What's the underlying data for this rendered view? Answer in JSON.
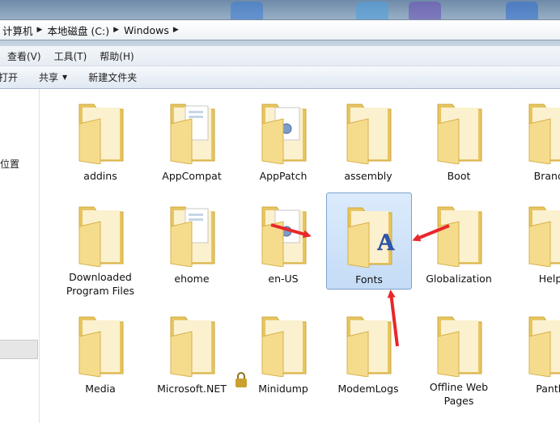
{
  "breadcrumb": {
    "items": [
      "计算机",
      "本地磁盘 (C:)",
      "Windows"
    ]
  },
  "menu": {
    "items": [
      "查看(V)",
      "工具(T)",
      "帮助(H)"
    ]
  },
  "toolbar": {
    "open_label": "打开",
    "share_label": "共享",
    "new_folder_label": "新建文件夹"
  },
  "nav": {
    "location_label": "位置"
  },
  "folders": [
    {
      "label": "addins"
    },
    {
      "label": "AppCompat"
    },
    {
      "label": "AppPatch"
    },
    {
      "label": "assembly"
    },
    {
      "label": "Boot"
    },
    {
      "label": "Brandi"
    },
    {
      "label": "Downloaded Program Files"
    },
    {
      "label": "ehome"
    },
    {
      "label": "en-US"
    },
    {
      "label": "Fonts",
      "selected": true
    },
    {
      "label": "Globalization"
    },
    {
      "label": "Help"
    },
    {
      "label": "Media"
    },
    {
      "label": "Microsoft.NET"
    },
    {
      "label": "Minidump",
      "locked": true
    },
    {
      "label": "ModemLogs"
    },
    {
      "label": "Offline Web Pages"
    },
    {
      "label": "Panth"
    }
  ],
  "colors": {
    "selection": "#cfe3f9",
    "annotation_arrow": "#e8272a",
    "folder": "#f2d47a"
  }
}
